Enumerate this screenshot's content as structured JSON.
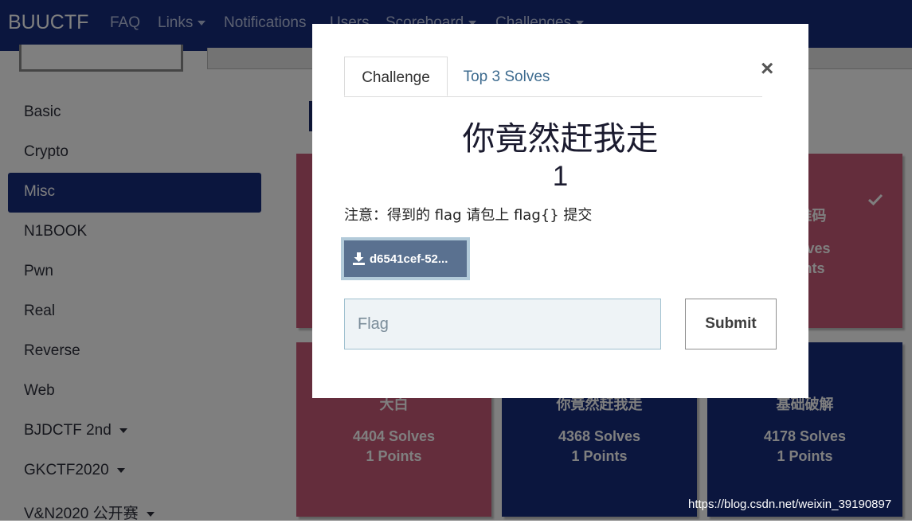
{
  "navbar": {
    "brand": "BUUCTF",
    "items": [
      {
        "label": "FAQ"
      },
      {
        "label": "Links"
      },
      {
        "label": "Notifications"
      },
      {
        "label": "Users"
      },
      {
        "label": "Scoreboard"
      },
      {
        "label": "Challenges"
      }
    ]
  },
  "sidebar": {
    "items": [
      {
        "label": "Basic"
      },
      {
        "label": "Crypto"
      },
      {
        "label": "Misc"
      },
      {
        "label": "N1BOOK"
      },
      {
        "label": "Pwn"
      },
      {
        "label": "Real"
      },
      {
        "label": "Reverse"
      },
      {
        "label": "Web"
      },
      {
        "label": "BJDCTF 2nd"
      },
      {
        "label": "GKCTF2020"
      },
      {
        "label": "V&N2020 公开赛"
      }
    ],
    "active": "Misc"
  },
  "cards": [
    {
      "name": "",
      "solves": "",
      "points": "",
      "color": "#c95b78"
    },
    {
      "name": "",
      "solves": "",
      "points": "",
      "color": "#c95b78"
    },
    {
      "name": "…维码",
      "solves": "…olves",
      "points": "…ints",
      "color": "#c95b78",
      "solved": true
    },
    {
      "name": "大白",
      "solves": "4404 Solves",
      "points": "1 Points",
      "color": "#c95b78"
    },
    {
      "name": "你竟然赶我走",
      "solves": "4368 Solves",
      "points": "1 Points",
      "color": "#172c7c"
    },
    {
      "name": "基础破解",
      "solves": "4178 Solves",
      "points": "1 Points",
      "color": "#172c7c"
    }
  ],
  "modal": {
    "tabs": [
      {
        "label": "Challenge"
      },
      {
        "label": "Top 3 Solves"
      }
    ],
    "close_symbol": "×",
    "name": "你竟然赶我走",
    "points": "1",
    "description": "注意：得到的 flag 请包上 flag{} 提交",
    "file_label": "d6541cef-52...",
    "flag_placeholder": "Flag",
    "submit_label": "Submit"
  },
  "watermark": "https://blog.csdn.net/weixin_39190897",
  "colors": {
    "navbar": "#172c7c",
    "solved_card": "#c95b78",
    "unsolved_card": "#172c7c",
    "download_button": "#5a7190"
  }
}
